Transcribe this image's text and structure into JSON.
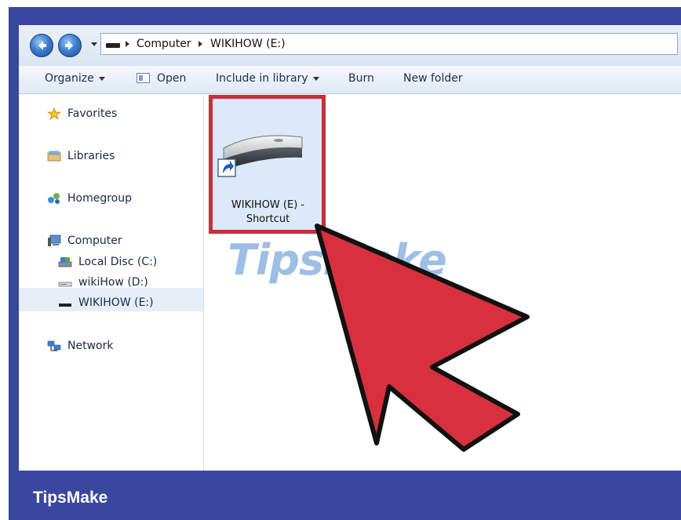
{
  "address_bar": {
    "crumbs": [
      "Computer",
      "WIKIHOW (E:)"
    ]
  },
  "toolbar": {
    "organize_label": "Organize",
    "open_label": "Open",
    "include_label": "Include in library",
    "burn_label": "Burn",
    "new_folder_label": "New folder"
  },
  "sidebar": {
    "favorites": "Favorites",
    "libraries": "Libraries",
    "homegroup": "Homegroup",
    "computer": "Computer",
    "local_disc": "Local Disc (C:)",
    "wikihow_d": "wikiHow (D:)",
    "wikihow_e": "WIKIHOW (E:)",
    "network": "Network"
  },
  "content": {
    "file_line1": "WIKIHOW (E) -",
    "file_line2": "Shortcut"
  },
  "watermark": "TipsMake",
  "footer_brand": "TipsMake",
  "colors": {
    "frame": "#3a479e",
    "highlight_box": "#c5303a",
    "arrow": "#d8303e"
  }
}
